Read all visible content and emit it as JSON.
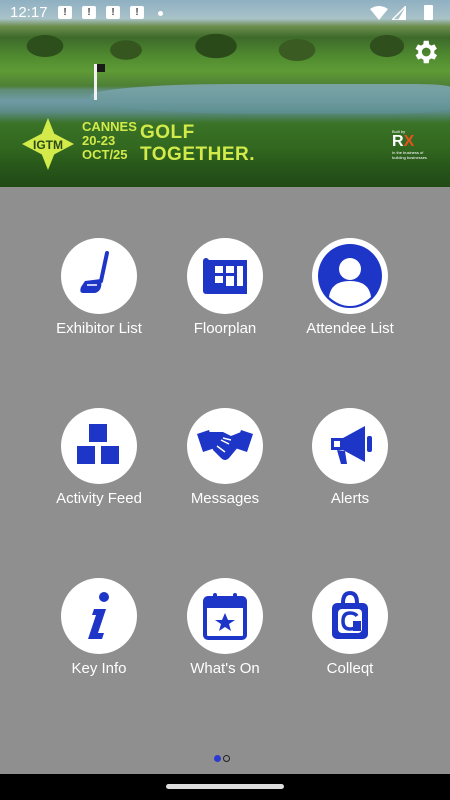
{
  "status_bar": {
    "time": "12:17",
    "notifications": [
      "!",
      "!",
      "!",
      "!"
    ]
  },
  "header": {
    "badge_text": "IGTM",
    "city": "CANNES",
    "dates_line1": "20-23",
    "dates_line2": "OCT/25",
    "tagline_line1": "GOLF",
    "tagline_line2": "TOGETHER.",
    "built_by": "Built by",
    "rx_logo_r": "R",
    "rx_logo_x": "X",
    "rx_sub": "In the business of building businesses",
    "accent_color": "#d2ea4a"
  },
  "tiles": [
    {
      "label": "Exhibitor List",
      "icon": "golf-club-icon"
    },
    {
      "label": "Floorplan",
      "icon": "floorplan-icon"
    },
    {
      "label": "Attendee List",
      "icon": "person-icon"
    },
    {
      "label": "Activity Feed",
      "icon": "boxes-icon"
    },
    {
      "label": "Messages",
      "icon": "handshake-icon"
    },
    {
      "label": "Alerts",
      "icon": "megaphone-icon"
    },
    {
      "label": "Key Info",
      "icon": "info-icon"
    },
    {
      "label": "What's On",
      "icon": "calendar-star-icon"
    },
    {
      "label": "Colleqt",
      "icon": "colleqt-bag-icon"
    }
  ],
  "icon_color": "#1e36c8",
  "pager": {
    "total": 2,
    "current": 1
  }
}
